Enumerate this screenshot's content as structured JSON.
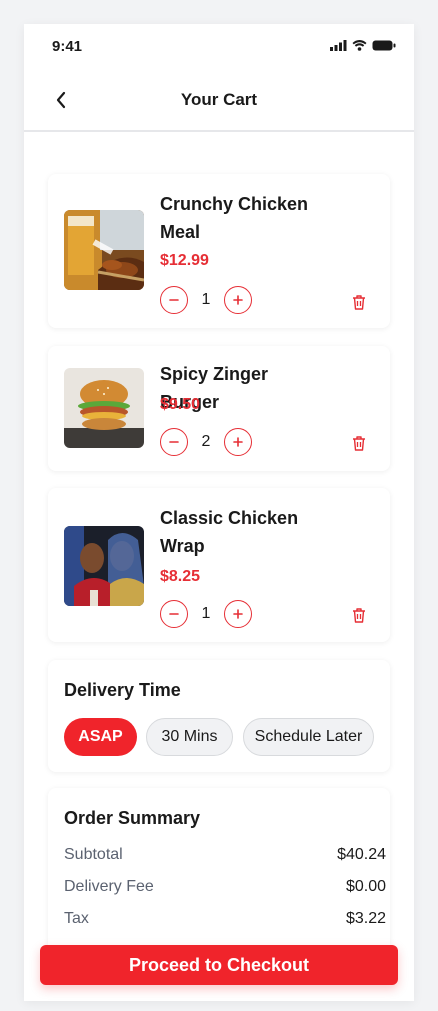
{
  "status_bar": {
    "time": "9:41"
  },
  "header": {
    "title": "Your Cart"
  },
  "cart": {
    "items": [
      {
        "name": "Crunchy Chicken Meal",
        "price": "$12.99",
        "quantity": "1"
      },
      {
        "name": "Spicy Zinger Burger",
        "price": "$9.50",
        "quantity": "2"
      },
      {
        "name": "Classic Chicken Wrap",
        "price": "$8.25",
        "quantity": "1"
      }
    ]
  },
  "delivery": {
    "title": "Delivery Time",
    "options": [
      "ASAP",
      "30 Mins",
      "Schedule Later"
    ],
    "selected": "ASAP"
  },
  "summary": {
    "title": "Order Summary",
    "rows": [
      {
        "label": "Subtotal",
        "value": "$40.24"
      },
      {
        "label": "Delivery Fee",
        "value": "$0.00"
      },
      {
        "label": "Tax",
        "value": "$3.22"
      }
    ]
  },
  "checkout": {
    "label": "Proceed to Checkout"
  },
  "colors": {
    "accent": "#f0242b",
    "price": "#e62e35"
  },
  "icons": {
    "back": "chevron-left-icon",
    "minus": "minus-circle-icon",
    "plus": "plus-circle-icon",
    "delete": "trash-icon"
  }
}
